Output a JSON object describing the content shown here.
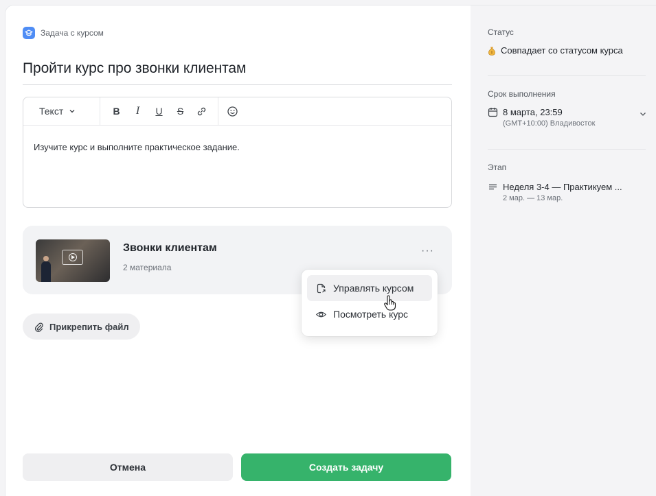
{
  "task": {
    "type_label": "Задача с курсом",
    "title": "Пройти курс про звонки клиентам"
  },
  "editor": {
    "style_label": "Текст",
    "body": "Изучите курс и выполните практическое задание."
  },
  "course": {
    "name": "Звонки клиентам",
    "materials": "2 материала",
    "more": "···"
  },
  "menu": {
    "manage": "Управлять курсом",
    "view": "Посмотреть курс"
  },
  "attach_label": "Прикрепить файл",
  "footer": {
    "cancel": "Отмена",
    "create": "Создать задачу"
  },
  "sidebar": {
    "status_label": "Статус",
    "status_value": "Совпадает со статусом курса",
    "deadline_label": "Срок выполнения",
    "deadline_value": "8 марта, 23:59",
    "deadline_tz": "(GMT+10:00) Владивосток",
    "stage_label": "Этап",
    "stage_value": "Неделя 3-4 — Практикуем ...",
    "stage_dates": "2 мар. — 13 мар."
  },
  "colors": {
    "primary_green": "#36b36b",
    "badge_blue": "#4f8df5"
  }
}
